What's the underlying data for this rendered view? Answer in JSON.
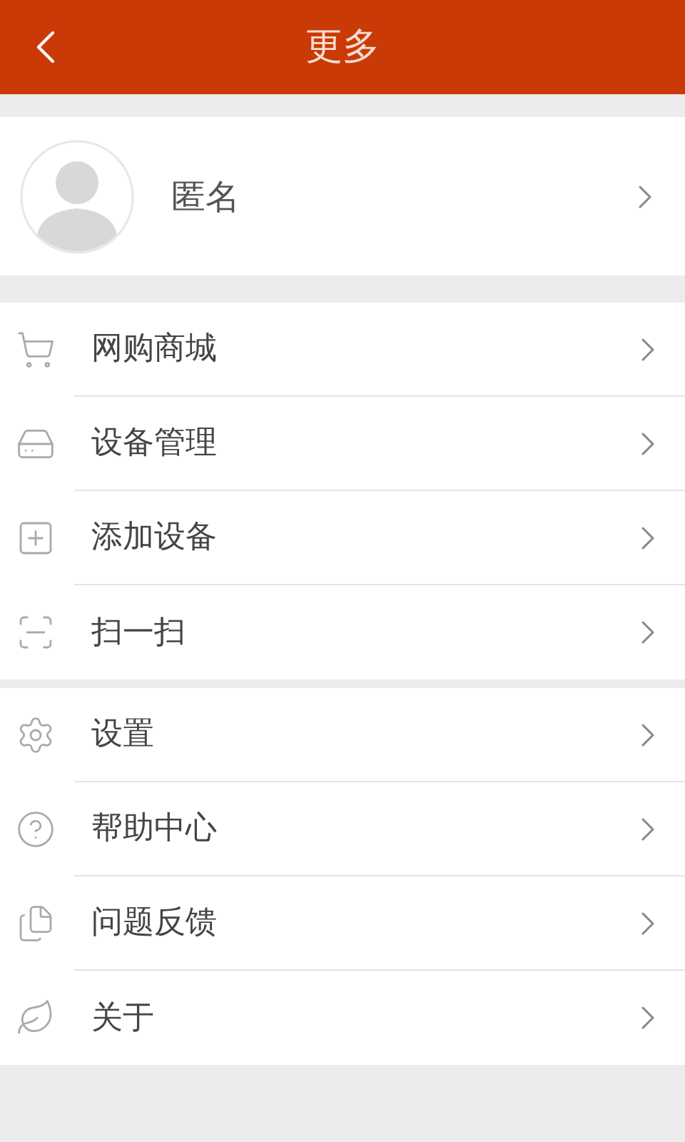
{
  "header": {
    "title": "更多"
  },
  "profile": {
    "name": "匿名"
  },
  "groups": [
    {
      "items": [
        {
          "label": "网购商城"
        },
        {
          "label": "设备管理"
        },
        {
          "label": "添加设备"
        },
        {
          "label": "扫一扫"
        }
      ]
    },
    {
      "items": [
        {
          "label": "设置"
        },
        {
          "label": "帮助中心"
        },
        {
          "label": "问题反馈"
        },
        {
          "label": "关于"
        }
      ]
    }
  ]
}
